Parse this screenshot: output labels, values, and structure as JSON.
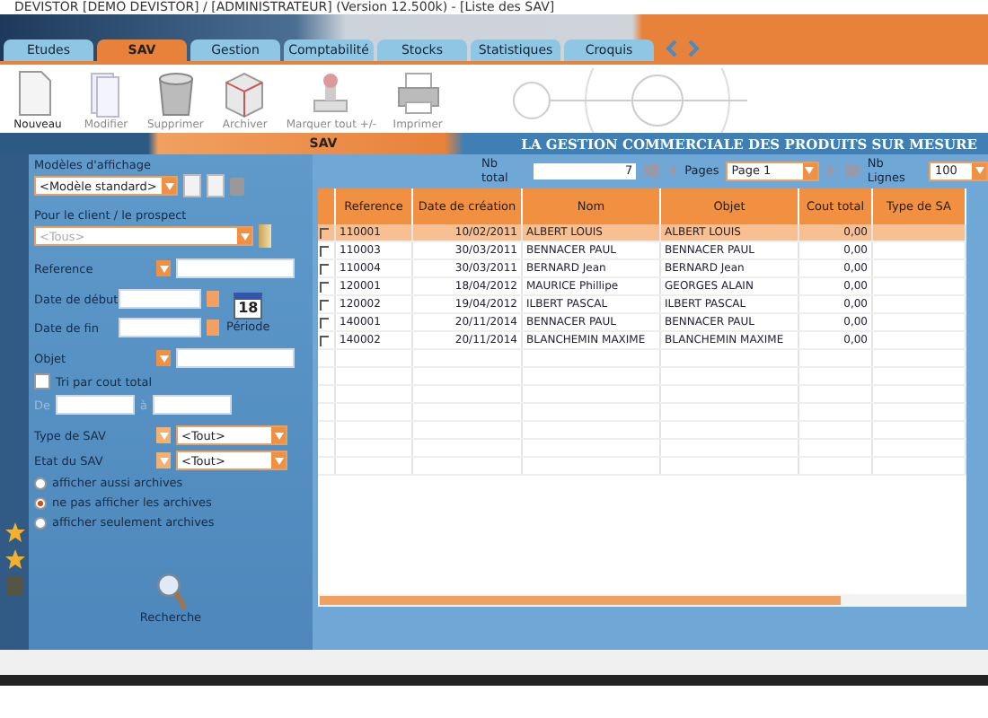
{
  "window": {
    "title": "DEVISTOR [DEMO DEVISTOR] / [ADMINISTRATEUR] (Version 12.500k) - [Liste des SAV]"
  },
  "tabs": [
    {
      "label": "Etudes",
      "selected": false
    },
    {
      "label": "SAV",
      "selected": true
    },
    {
      "label": "Gestion",
      "selected": false
    },
    {
      "label": "Comptabilité",
      "selected": false
    },
    {
      "label": "Stocks",
      "selected": false
    },
    {
      "label": "Statistiques",
      "selected": false
    },
    {
      "label": "Croquis",
      "selected": false
    }
  ],
  "toolbar": [
    {
      "label": "Nouveau",
      "kind": "page",
      "disabled": false
    },
    {
      "label": "Modifier",
      "kind": "pages",
      "disabled": true
    },
    {
      "label": "Supprimer",
      "kind": "bin",
      "disabled": true
    },
    {
      "label": "Archiver",
      "kind": "box",
      "disabled": true
    },
    {
      "label": "Marquer tout +/-",
      "kind": "stamp",
      "disabled": true
    },
    {
      "label": "Imprimer",
      "kind": "printer",
      "disabled": true
    }
  ],
  "section": {
    "title": "SAV",
    "slogan": "LA GESTION COMMERCIALE DES PRODUITS SUR MESURE"
  },
  "filters": {
    "display_models_label": "Modèles d'affichage",
    "display_model": "<Modèle standard>",
    "client_label": "Pour le client / le prospect",
    "client": "<Tous>",
    "reference_label": "Reference",
    "start_label": "Date de début",
    "end_label": "Date de fin",
    "calendar_day": "18",
    "period_button": "Période",
    "object_label": "Objet",
    "sort_by_cost": {
      "label": "Tri par cout total",
      "checked": false
    },
    "from_label": "De",
    "to_label": "à",
    "type_label": "Type de SAV",
    "type": "<Tout>",
    "state_label": "Etat du SAV",
    "state": "<Tout>",
    "archive_options": [
      {
        "label": "afficher aussi archives",
        "selected": false
      },
      {
        "label": "ne pas afficher les archives",
        "selected": true
      },
      {
        "label": "afficher seulement archives",
        "selected": false
      }
    ],
    "search_button": "Recherche"
  },
  "pager": {
    "total_label": "Nb total",
    "total": "7",
    "pages_label": "Pages",
    "page": "Page 1",
    "lines_label": "Nb Lignes",
    "lines": "100"
  },
  "table": {
    "columns": [
      "Reference",
      "Date de création",
      "Nom",
      "Objet",
      "Cout total",
      "Type de SA"
    ],
    "rows": [
      {
        "cells": [
          "110001",
          "10/02/2011",
          "ALBERT LOUIS",
          "ALBERT LOUIS",
          "0,00",
          ""
        ],
        "selected": true
      },
      {
        "cells": [
          "110003",
          "30/03/2011",
          "BENNACER PAUL",
          "BENNACER PAUL",
          "0,00",
          ""
        ],
        "selected": false
      },
      {
        "cells": [
          "110004",
          "30/03/2011",
          "BERNARD Jean",
          "BERNARD Jean",
          "0,00",
          ""
        ],
        "selected": false
      },
      {
        "cells": [
          "120001",
          "18/04/2012",
          "MAURICE Phillipe",
          "GEORGES ALAIN",
          "0,00",
          ""
        ],
        "selected": false
      },
      {
        "cells": [
          "120002",
          "19/04/2012",
          "ILBERT PASCAL",
          "ILBERT PASCAL",
          "0,00",
          ""
        ],
        "selected": false
      },
      {
        "cells": [
          "140001",
          "20/11/2014",
          "BENNACER PAUL",
          "BENNACER PAUL",
          "0,00",
          ""
        ],
        "selected": false
      },
      {
        "cells": [
          "140002",
          "20/11/2014",
          "BLANCHEMIN MAXIME",
          "BLANCHEMIN MAXIME",
          "0,00",
          ""
        ],
        "selected": false
      }
    ]
  }
}
